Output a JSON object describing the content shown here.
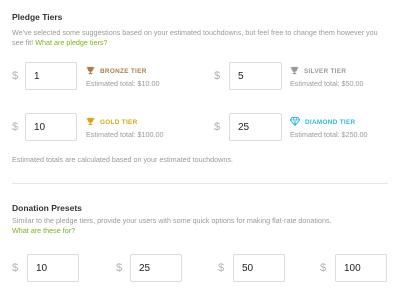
{
  "pledge": {
    "title": "Pledge Tiers",
    "description": "We've selected some suggestions based on your estimated touchdowns, but feel free to change them however you see fit!",
    "link": "What are pledge tiers?",
    "currency_symbol": "$",
    "tiers": [
      {
        "name": "BRONZE TIER",
        "value": "1",
        "estimate_label": "Estimated total:",
        "estimate": "$10.00",
        "color": "#a5804a",
        "icon": "trophy-icon"
      },
      {
        "name": "SILVER TIER",
        "value": "5",
        "estimate_label": "Estimated total:",
        "estimate": "$50.00",
        "color": "#9a9a9a",
        "icon": "trophy-icon"
      },
      {
        "name": "GOLD TIER",
        "value": "10",
        "estimate_label": "Estimated total:",
        "estimate": "$100.00",
        "color": "#d9a61a",
        "icon": "trophy-icon"
      },
      {
        "name": "DIAMOND TIER",
        "value": "25",
        "estimate_label": "Estimated total:",
        "estimate": "$250.00",
        "color": "#35b8d6",
        "icon": "diamond-icon"
      }
    ],
    "footnote": "Estimated totals are calculated based on your estimated touchdowns."
  },
  "donation": {
    "title": "Donation Presets",
    "description": "Similar to the pledge tiers, provide your users with some quick options for making flat-rate donations.",
    "link": "What are these for?",
    "currency_symbol": "$",
    "presets": [
      "10",
      "25",
      "50",
      "100"
    ]
  },
  "colors": {
    "link": "#7ab41d",
    "muted_text": "#9a9a9a",
    "border": "#dcdcdc"
  }
}
